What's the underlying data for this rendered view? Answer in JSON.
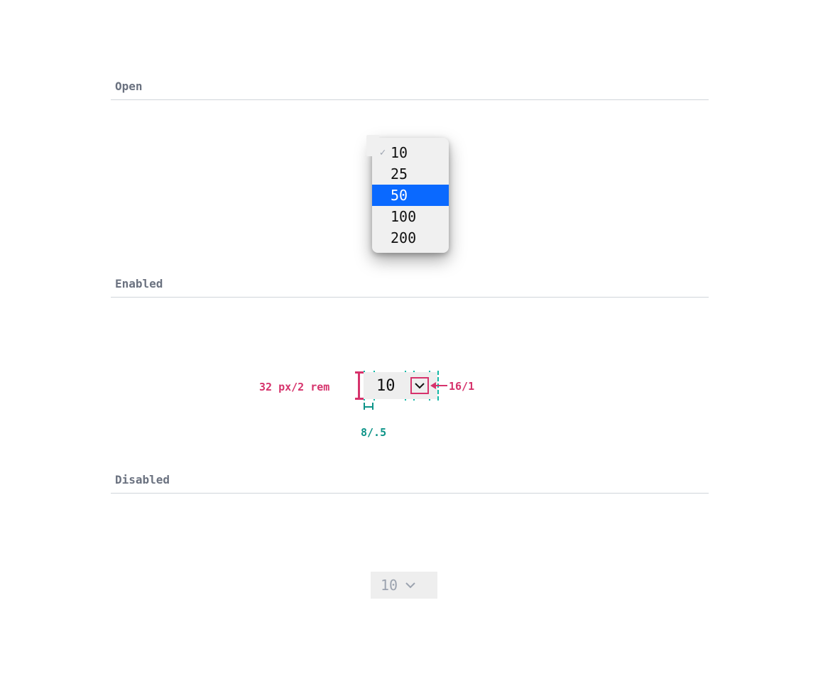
{
  "sections": {
    "open": {
      "title": "Open"
    },
    "enabled": {
      "title": "Enabled"
    },
    "disabled": {
      "title": "Disabled"
    }
  },
  "open_dropdown": {
    "options": [
      {
        "label": "10",
        "checked": true,
        "highlighted": false
      },
      {
        "label": "25",
        "checked": false,
        "highlighted": false
      },
      {
        "label": "50",
        "checked": false,
        "highlighted": true
      },
      {
        "label": "100",
        "checked": false,
        "highlighted": false
      },
      {
        "label": "200",
        "checked": false,
        "highlighted": false
      }
    ]
  },
  "enabled_select": {
    "value": "10",
    "annotations": {
      "height": "32 px/2 rem",
      "icon_box": "16/1",
      "padding": "8/.5"
    }
  },
  "disabled_select": {
    "value": "10"
  },
  "colors": {
    "pink": "#d6336c",
    "teal": "#0d9488",
    "highlight": "#0a69ff"
  }
}
